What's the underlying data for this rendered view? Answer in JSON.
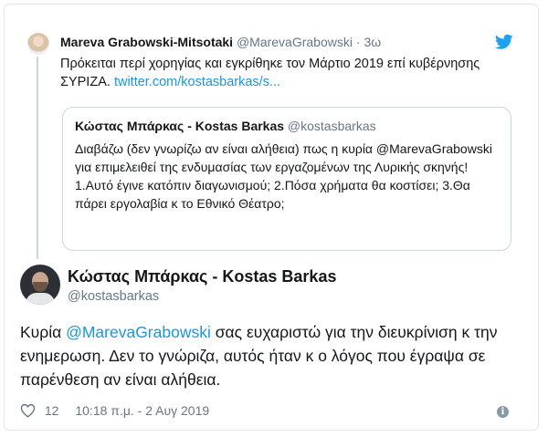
{
  "parent_tweet": {
    "author_name": "Mareva Grabowski-Mitsotaki",
    "author_handle": "@MarevaGrabowski",
    "separator": "·",
    "time": "3ω",
    "text": "Πρόκειται περί χορηγίας  και εγκρίθηκε τον Μάρτιο 2019 επί κυβέρνησης ΣΥΡΙΖΑ.",
    "link": "twitter.com/kostasbarkas/s..."
  },
  "quoted_tweet": {
    "author_name": "Κώστας Μπάρκας - Kostas Barkas",
    "author_handle": "@kostasbarkas",
    "text": "Διαβάζω (δεν γνωρίζω αν είναι αλήθεια) πως η κυρία @MarevaGrabowski για επιμελειθεί της ενδυμασίας των εργαζομένων της Λυρικής σκηνής! 1.Αυτό έγινε κατόπιν διαγωνισμού; 2.Πόσα χρήματα θα κοστίσει; 3.Θα πάρει εργολαβία κ το Εθνικό Θέατρο;"
  },
  "main_tweet": {
    "author_name": "Κώστας Μπάρκας - Kostas Barkas",
    "author_handle": "@kostasbarkas",
    "text_prefix": "Κυρία ",
    "mention": "@MarevaGrabowski",
    "text_suffix": " σας ευχαριστώ για την διευκρίνιση κ την ενημερωση. Δεν το γνώριζα, αυτός ήταν κ ο λόγος που έγραψα σε παρένθεση αν είναι αλήθεια.",
    "likes": "12",
    "timestamp": "10:18 π.μ. - 2 Αυγ 2019"
  },
  "icons": {
    "brand": "twitter-bird-icon",
    "like": "heart-icon",
    "info": "info-icon"
  },
  "colors": {
    "link": "#1b95e0",
    "muted": "#657786",
    "border": "#ccd6dd"
  }
}
